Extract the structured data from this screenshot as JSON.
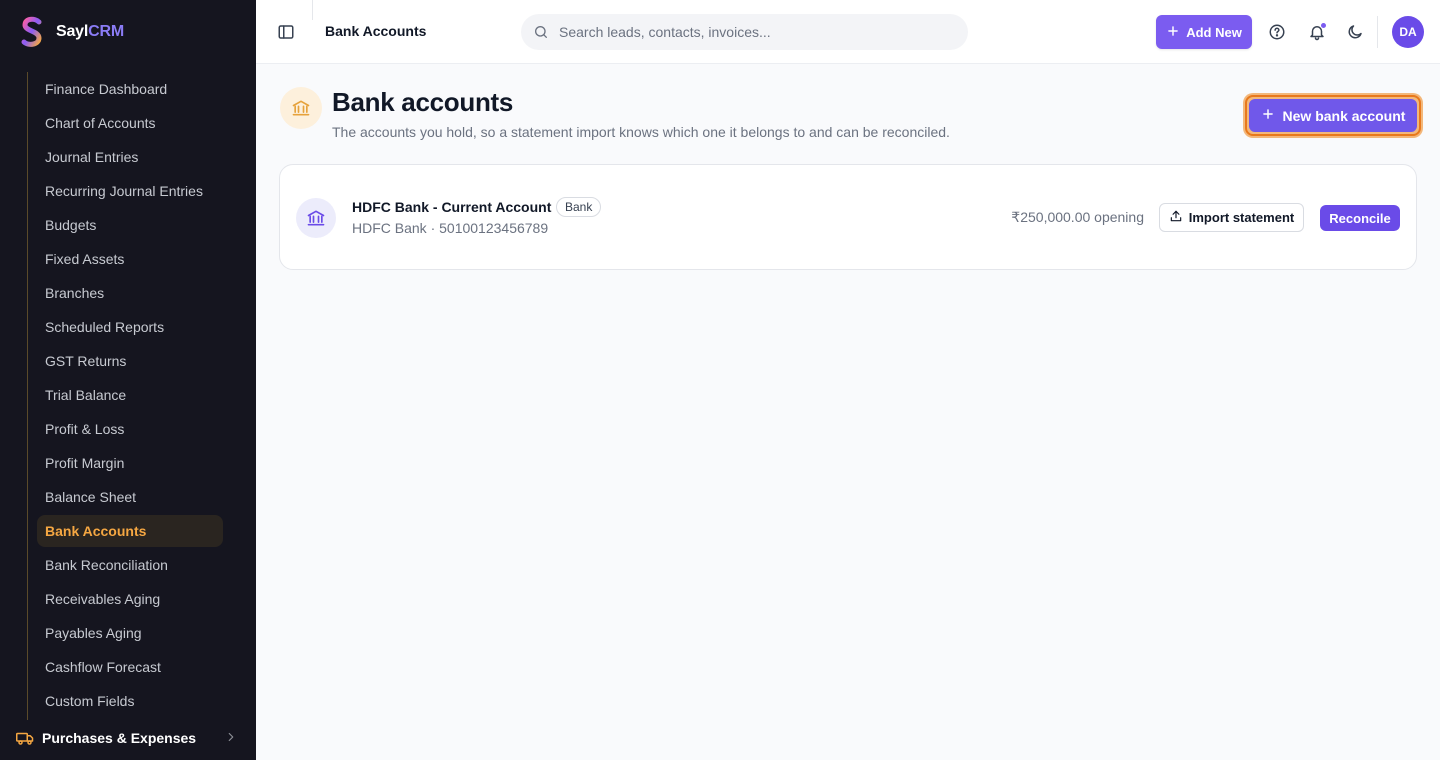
{
  "app": {
    "name_prefix": "Sayl",
    "name_accent": "CRM",
    "logo_icon": "sayl-logo-s"
  },
  "sidebar": {
    "items": [
      {
        "label": "Finance Dashboard"
      },
      {
        "label": "Chart of Accounts"
      },
      {
        "label": "Journal Entries"
      },
      {
        "label": "Recurring Journal Entries"
      },
      {
        "label": "Budgets"
      },
      {
        "label": "Fixed Assets"
      },
      {
        "label": "Branches"
      },
      {
        "label": "Scheduled Reports"
      },
      {
        "label": "GST Returns"
      },
      {
        "label": "Trial Balance"
      },
      {
        "label": "Profit & Loss"
      },
      {
        "label": "Profit Margin"
      },
      {
        "label": "Balance Sheet"
      },
      {
        "label": "Bank Accounts",
        "active": true
      },
      {
        "label": "Bank Reconciliation"
      },
      {
        "label": "Receivables Aging"
      },
      {
        "label": "Payables Aging"
      },
      {
        "label": "Cashflow Forecast"
      },
      {
        "label": "Custom Fields"
      }
    ],
    "section": {
      "label": "Purchases & Expenses",
      "icon": "truck-icon"
    }
  },
  "topbar": {
    "title": "Bank Accounts",
    "search_placeholder": "Search leads, contacts, invoices...",
    "add_new_label": "Add New",
    "avatar_initials": "DA"
  },
  "page": {
    "title": "Bank accounts",
    "subtitle": "The accounts you hold, so a statement import knows which one it belongs to and can be reconciled.",
    "new_button_label": "New bank account"
  },
  "accounts": [
    {
      "name": "HDFC Bank - Current Account",
      "badge": "Bank",
      "detail": "HDFC Bank · 50100123456789",
      "opening": "₹250,000.00 opening",
      "import_label": "Import statement",
      "reconcile_label": "Reconcile"
    }
  ],
  "colors": {
    "sidebar_bg": "#15151f",
    "accent_purple": "#7058ea",
    "active_orange": "#f5a742",
    "focus_ring": "#e8781c"
  }
}
